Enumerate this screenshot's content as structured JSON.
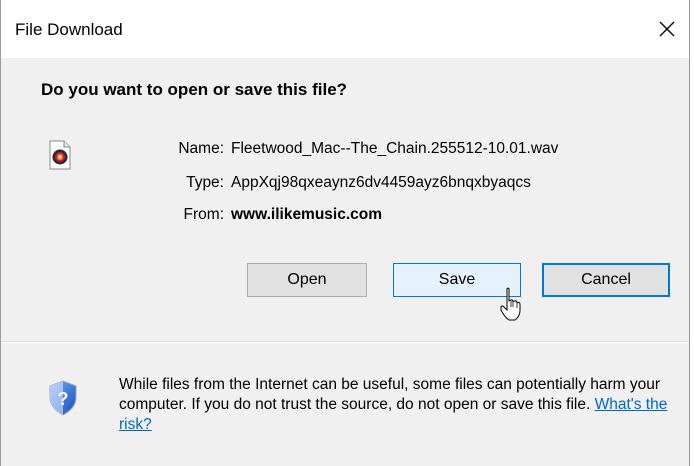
{
  "dialog": {
    "title": "File Download",
    "question": "Do you want to open or save this file?"
  },
  "file": {
    "name_label": "Name:",
    "name_value": "Fleetwood_Mac--The_Chain.255512-10.01.wav",
    "type_label": "Type:",
    "type_value": "AppXqj98qxeaynz6dv4459ayz6bnqxbyaqcs",
    "from_label": "From:",
    "from_value": "www.ilikemusic.com",
    "icon": "audio-file-icon"
  },
  "buttons": {
    "open": "Open",
    "save": "Save",
    "cancel": "Cancel"
  },
  "warning": {
    "text": "While files from the Internet can be useful, some files can potentially harm your computer. If you do not trust the source, do not open or save this file.",
    "link": "What's the risk?",
    "icon": "shield-help-icon"
  },
  "colors": {
    "accent": "#0078d7",
    "link": "#0066cc",
    "dialog_bg": "#f0f0f0"
  }
}
